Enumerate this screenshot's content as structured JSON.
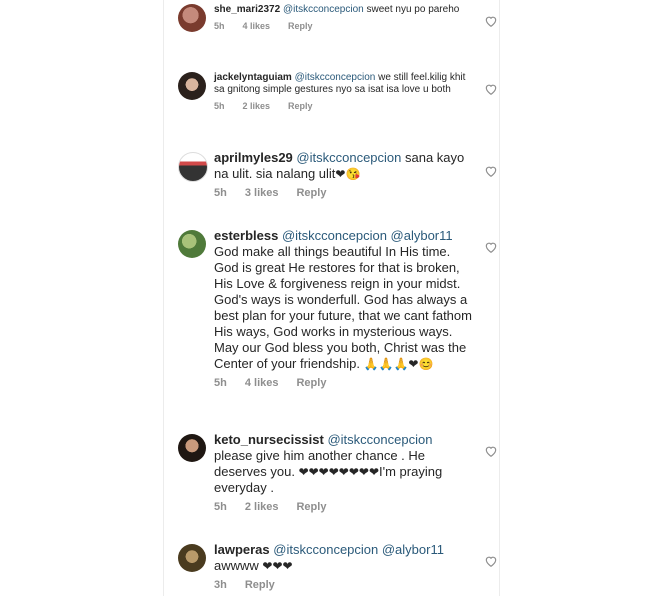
{
  "comments": [
    {
      "username": "she_mari2372",
      "mention": "@itskcconcepcion",
      "text": "sweet nyu po pareho",
      "time": "5h",
      "likes": "4 likes",
      "reply": "Reply"
    },
    {
      "username": "jackelyntaguiam",
      "mention": "@itskcconcepcion",
      "text": "we still feel.kilig khit sa gnitong simple gestures nyo sa isat isa love u both",
      "time": "5h",
      "likes": "2 likes",
      "reply": "Reply"
    },
    {
      "username": "aprilmyles29",
      "mention": "@itskcconcepcion",
      "text": "sana kayo na ulit. sia nalang ulit",
      "emoji": "❤😘",
      "time": "5h",
      "likes": "3 likes",
      "reply": "Reply"
    },
    {
      "username": "esterbless",
      "mention": "@itskcconcepcion @alybor11",
      "text": "God make all things beautiful In His time. God is great He restores for that is broken, His Love & forgiveness reign in your midst. God's ways is wonderfull. God has always a best plan for your future, that we cant fathom His ways, God works in mysterious ways. May our God bless you both, Christ was the Center of your friendship.",
      "emoji": "🙏🙏🙏❤😊",
      "time": "5h",
      "likes": "4 likes",
      "reply": "Reply"
    },
    {
      "username": "keto_nursecissist",
      "mention": "@itskcconcepcion",
      "text": "please give him another chance . He deserves you.",
      "emoji": "❤❤❤❤❤❤❤❤",
      "text2": "I'm praying everyday .",
      "time": "5h",
      "likes": "2 likes",
      "reply": "Reply"
    },
    {
      "username": "lawperas",
      "mention": "@itskcconcepcion @alybor11",
      "text": "awwww",
      "emoji": "❤❤❤",
      "time": "3h",
      "reply": "Reply"
    }
  ],
  "colors": {
    "mention": "#2b5a7a",
    "meta": "#8e8e8e",
    "heart": "#8e8e8e"
  },
  "icons": {
    "like": "heart-outline-icon",
    "avatar": "profile-avatar"
  }
}
